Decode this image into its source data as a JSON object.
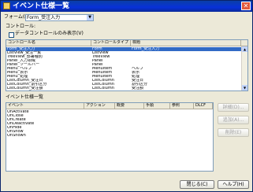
{
  "window": {
    "title": "イベント仕様一覧",
    "close_glyph": "✕"
  },
  "form": {
    "label": "フォーム(F):",
    "value": "Form_受注入力"
  },
  "controls_section": {
    "label": "コントロール:",
    "checkbox_label": "データコントロールのみ表示(V)",
    "columns": [
      "コントロール名",
      "コントロールタイプ",
      "標題"
    ],
    "rows": [
      [
        "Form_受注入力",
        "Form",
        "Form_受注入力"
      ],
      [
        "ListView_受注一覧",
        "ListView",
        ""
      ],
      [
        "TreeView_部署種別",
        "TreeView",
        ""
      ],
      [
        "Panel_入力領域",
        "Panel",
        ""
      ],
      [
        "Panel_ツールバー",
        "Panel",
        ""
      ],
      [
        "Menu_ヘルプ",
        "MenuItem",
        "ヘルプ"
      ],
      [
        "Menu_表示",
        "MenuItem",
        "表示"
      ],
      [
        "Menu_処理",
        "MenuItem",
        "処理"
      ],
      [
        "ListColumn_受注日",
        "ListColumn",
        "受注日"
      ],
      [
        "ListColumn_割引区分",
        "ListColumn",
        "割引区分"
      ],
      [
        "ListColumn_受注額",
        "ListColumn",
        "受注額"
      ]
    ],
    "selected_row": 0
  },
  "events_section": {
    "label": "イベント仕様一覧",
    "columns": [
      "イベント",
      "アクション",
      "概要",
      "手順",
      "参照",
      "DLCF"
    ],
    "rows": [
      "OnActivate",
      "OnClose",
      "OnCreate",
      "OnDeactivate",
      "OnHide",
      "OnShow",
      "OnShown"
    ]
  },
  "side_buttons": {
    "detail": "詳細(D)...",
    "add": "追加(A)...",
    "delete": "削除(E)"
  },
  "footer_buttons": {
    "close": "閉じる(C)",
    "help": "ヘルプ(H)"
  }
}
